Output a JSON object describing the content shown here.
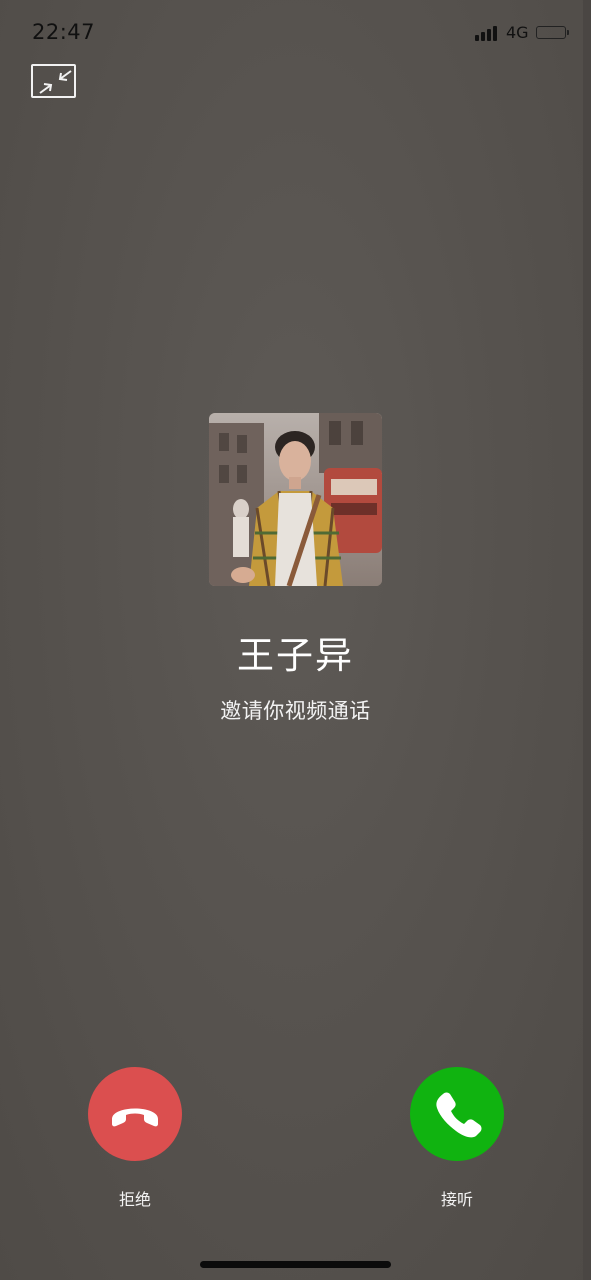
{
  "status_bar": {
    "time": "22:47",
    "network": "4G",
    "icons": [
      "signal-icon",
      "battery-icon"
    ]
  },
  "toolbar": {
    "minimize_icon": "minimize-arrows-icon"
  },
  "caller": {
    "name": "王子异",
    "subtitle": "邀请你视频通话",
    "avatar_icon": "avatar-photo"
  },
  "actions": {
    "decline": {
      "label": "拒绝",
      "icon": "phone-hangup-icon",
      "color": "#db4f4f"
    },
    "accept": {
      "label": "接听",
      "icon": "phone-answer-icon",
      "color": "#10b310"
    }
  },
  "colors": {
    "background": "#57534f",
    "text": "#ffffff"
  }
}
